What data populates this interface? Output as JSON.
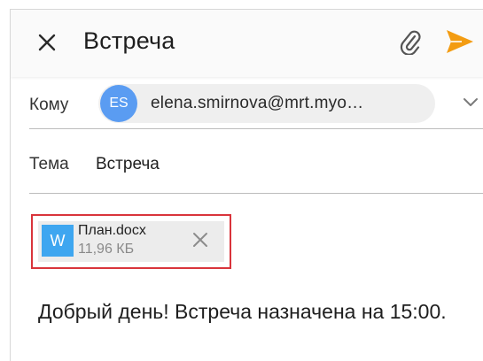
{
  "header": {
    "title": "Встреча",
    "close_icon": "close-icon",
    "attach_icon": "paperclip-icon",
    "send_icon": "send-icon",
    "send_color": "#f39c12"
  },
  "recipient": {
    "label": "Кому",
    "avatar_initials": "ES",
    "avatar_color": "#5a9cf2",
    "email": "elena.smirnova@mrt.myo…",
    "expand_icon": "chevron-down-icon"
  },
  "subject": {
    "label": "Тема",
    "value": "Встреча"
  },
  "attachment": {
    "icon_letter": "W",
    "icon_color": "#3ea6f0",
    "name": "План.docx",
    "size": "11,96 КБ",
    "remove_icon": "close-icon",
    "highlight_color": "#d9343b"
  },
  "body": {
    "text": "Добрый день! Встреча назначена на 15:00."
  }
}
